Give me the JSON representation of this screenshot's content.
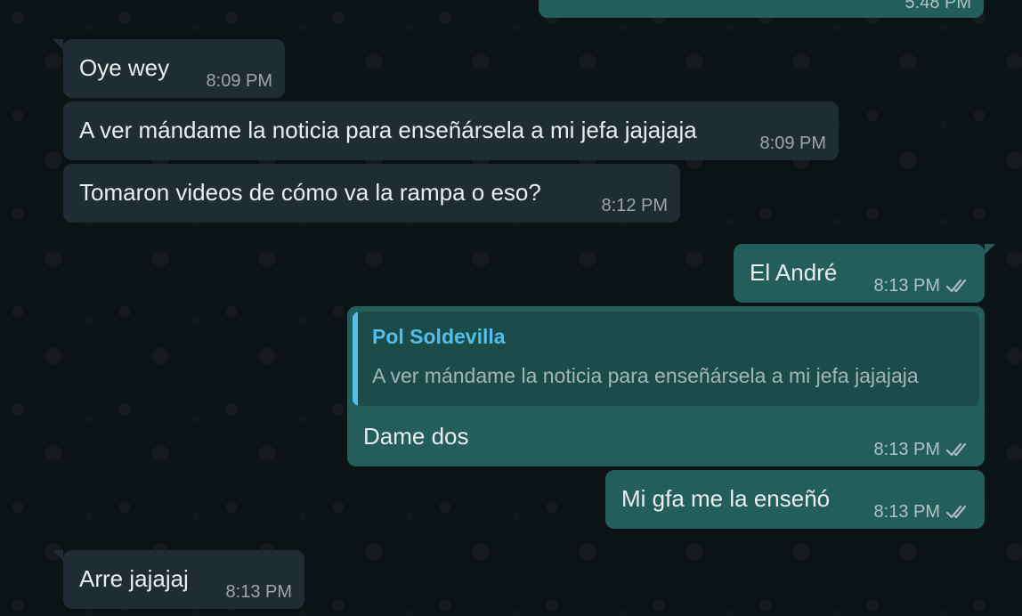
{
  "messages": [
    {
      "direction": "outgoing",
      "text": "",
      "time": "5:48 PM"
    },
    {
      "direction": "incoming",
      "text": "Oye wey",
      "time": "8:09 PM"
    },
    {
      "direction": "incoming",
      "text": "A ver mándame la noticia para enseñársela a mi jefa jajajaja",
      "time": "8:09 PM"
    },
    {
      "direction": "incoming",
      "text": "Tomaron videos de cómo va la rampa o eso?",
      "time": "8:12 PM"
    },
    {
      "direction": "outgoing",
      "text": "El André",
      "time": "8:13 PM",
      "status_icon": "double-check-icon"
    },
    {
      "direction": "outgoing",
      "text": "Dame dos",
      "time": "8:13 PM",
      "status_icon": "double-check-icon",
      "reply": {
        "author": "Pol Soldevilla",
        "text": "A ver mándame la noticia para enseñársela a mi jefa jajajaja"
      }
    },
    {
      "direction": "outgoing",
      "text": "Mi gfa me la enseñó",
      "time": "8:13 PM",
      "status_icon": "double-check-icon"
    },
    {
      "direction": "incoming",
      "text": "Arre jajajaj",
      "time": "8:13 PM"
    }
  ],
  "colors": {
    "background": "#0c1317",
    "incoming_bubble": "#202c33",
    "outgoing_bubble": "#235e5b",
    "quote_accent": "#53bdeb"
  }
}
